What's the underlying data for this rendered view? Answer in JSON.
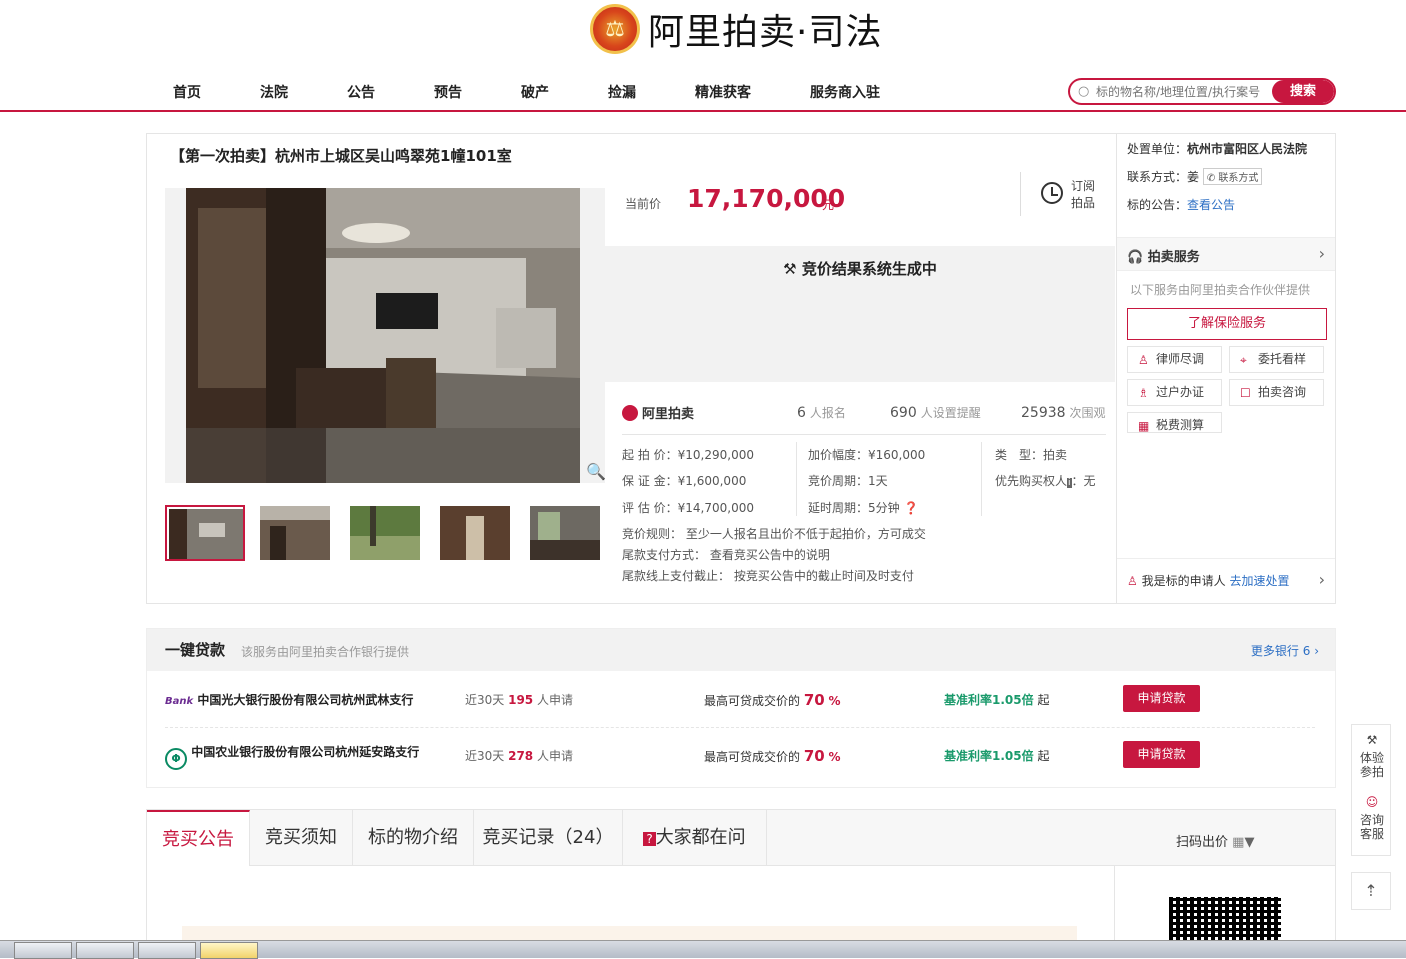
{
  "header": {
    "brand": "阿里拍卖·司法",
    "emblem_glyph": "⚖"
  },
  "nav": {
    "items": [
      "首页",
      "法院",
      "公告",
      "预告",
      "破产",
      "捡漏",
      "精准获客",
      "服务商入驻"
    ]
  },
  "search": {
    "placeholder": "标的物名称/地理位置/执行案号",
    "button": "搜索"
  },
  "item": {
    "title": "【第一次拍卖】杭州市上城区吴山鸣翠苑1幢101室",
    "price_label": "当前价",
    "price": "17,170,000",
    "price_unit": "元",
    "subscribe": [
      "订阅",
      "拍品"
    ],
    "status": "竞价结果系统生成中",
    "brand_mini": "阿里拍卖",
    "stats": [
      {
        "num": "6",
        "label": "人报名"
      },
      {
        "num": "690",
        "label": "人设置提醒"
      },
      {
        "num": "25938",
        "label": "次围观"
      }
    ],
    "details": {
      "start_price": "起 拍 价：¥10,290,000",
      "deposit": "保 证 金：¥1,600,000",
      "appraisal": "评 估 价：¥14,700,000",
      "increment": "加价幅度：¥160,000",
      "cycle": "竞价周期：1天",
      "delay": "延时周期：5分钟",
      "type": "类　型：拍卖",
      "priority": "优先购买权人",
      "priority_value": "：无",
      "rule": "竞价规则：  至少一人报名且出价不低于起拍价，方可成交",
      "tail_method": "尾款支付方式：  查看竞买公告中的说明",
      "tail_deadline": "尾款线上支付截止：  按竞买公告中的截止时间及时支付"
    }
  },
  "side": {
    "court_label": "处置单位：",
    "court": "杭州市富阳区人民法院",
    "contact_label": "联系方式：姜",
    "contact_btn": "联系方式",
    "notice_label": "标的公告：",
    "notice_link": "查看公告",
    "service_title": "拍卖服务",
    "service_note": "以下服务由阿里拍卖合作伙伴提供",
    "insurance": "了解保险服务",
    "services": [
      "律师尽调",
      "委托看样",
      "过户办证",
      "拍卖咨询",
      "税费测算"
    ],
    "applicant": "我是标的申请人",
    "applicant_link": "去加速处置"
  },
  "loan": {
    "title": "一键贷款",
    "note": "该服务由阿里拍卖合作银行提供",
    "more": "更多银行 6",
    "rows": [
      {
        "logo": "Bank",
        "bank": "中国光大银行股份有限公司杭州武林支行",
        "pre": "近30天",
        "count": "195",
        "post": "人申请",
        "max_pre": "最高可贷成交价的",
        "max": "70",
        "max_unit": "%",
        "rate": "基准利率1.05倍",
        "rate_post": "起",
        "apply": "申请贷款"
      },
      {
        "logo": "ABC",
        "bank": "中国农业银行股份有限公司杭州延安路支行",
        "pre": "近30天",
        "count": "278",
        "post": "人申请",
        "max_pre": "最高可贷成交价的",
        "max": "70",
        "max_unit": "%",
        "rate": "基准利率1.05倍",
        "rate_post": "起",
        "apply": "申请贷款"
      }
    ]
  },
  "tabs": [
    "竞买公告",
    "竞买须知",
    "标的物介绍",
    "竞买记录（24）",
    "大家都在问"
  ],
  "qr_label": "扫码出价",
  "float": {
    "bid": "体验参拍",
    "cs": "咨询客服"
  },
  "colors": {
    "accent": "#c7173f",
    "link": "#2d6fc4",
    "rate": "#1a9a6b"
  }
}
